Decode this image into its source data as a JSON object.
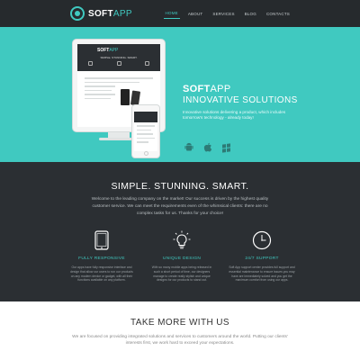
{
  "header": {
    "logo_bold": "SOFT",
    "logo_light": "APP",
    "nav": [
      {
        "label": "HOME",
        "active": true
      },
      {
        "label": "ABOUT",
        "active": false
      },
      {
        "label": "SERVICES",
        "active": false
      },
      {
        "label": "BLOG",
        "active": false
      },
      {
        "label": "CONTACTS",
        "active": false
      }
    ]
  },
  "hero": {
    "title_bold": "SOFT",
    "title_light": "APP",
    "subtitle": "INNOVATIVE SOLUTIONS",
    "description": "Innovative solutions delivering a product, which includes tomorrow's technology - already today!",
    "platforms": [
      "android-icon",
      "apple-icon",
      "windows-icon"
    ]
  },
  "features": {
    "title": "SIMPLE. STUNNING. SMART.",
    "intro": "Welcome to the leading company on the market! Our success is driven by the highest quality customer service. We can meet the requirements even of the whimsical clients: there are no complex tasks for us. Thanks for your choice!",
    "items": [
      {
        "icon": "tablet-icon",
        "name": "FULLY RESPONSIVE",
        "desc": "Our apps have fully responsive interface and design that allow our users to run our products on any modern device or gadget, with all their functions available on any platform."
      },
      {
        "icon": "lightbulb-icon",
        "name": "UNIQUE DESIGN",
        "desc": "With so many mobile apps being released in such a short period of time, our designers manage to create really stylish and unique designs for our products to stand out."
      },
      {
        "icon": "clock-icon",
        "name": "24/7 SUPPORT",
        "desc": "Soft App support center provides full support and essential maintenance to ensure issues you may have are immediately solved and you get the maximum comfort from using our apps."
      }
    ]
  },
  "more": {
    "title": "TAKE MORE WITH US",
    "description": "We are focused on providing integrated solutions and services to customers around the world. Putting our clients' interests first, we work hard to exceed your expectations."
  },
  "colors": {
    "accent": "#40c9c0",
    "dark": "#2b2f33",
    "header": "#262a2d"
  }
}
